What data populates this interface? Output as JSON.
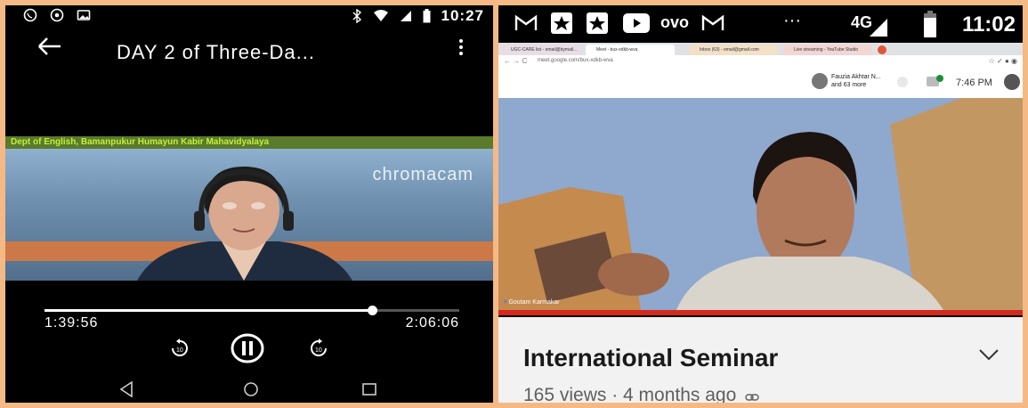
{
  "left_player": {
    "status": {
      "time": "10:27"
    },
    "title": "DAY 2 of Three-Da...",
    "video": {
      "banner": "Dept of English, Bamanpukur Humayun Kabir Mahavidyalaya",
      "watermark": "chromacam"
    },
    "playback": {
      "current_time": "1:39:56",
      "total_time": "2:06:06",
      "progress_fraction": 0.79
    }
  },
  "right_player": {
    "status": {
      "network": "4G",
      "time": "11:02",
      "ovo_label": "ovo"
    },
    "browser": {
      "tabs": [
        "UGC-CARE list - email@bymail...",
        "Meet - bux-xdkb-wva",
        "Inbox (63) - email@gmail.com",
        "Live streaming - YouTube Studio"
      ],
      "url": "meet.google.com/bux-xdkb-wva"
    },
    "meet": {
      "participants_label": "Fauzia Akhtar N... and 63 more",
      "clock": "7:46 PM",
      "speaker_name": "Goutam Karmakar"
    },
    "video_info": {
      "title": "International Seminar",
      "meta": "165 views · 4 months ago"
    }
  },
  "colors": {
    "frame": "#f5b985",
    "youtube_red": "#d42a1e",
    "banner_green": "#c2f03a"
  }
}
